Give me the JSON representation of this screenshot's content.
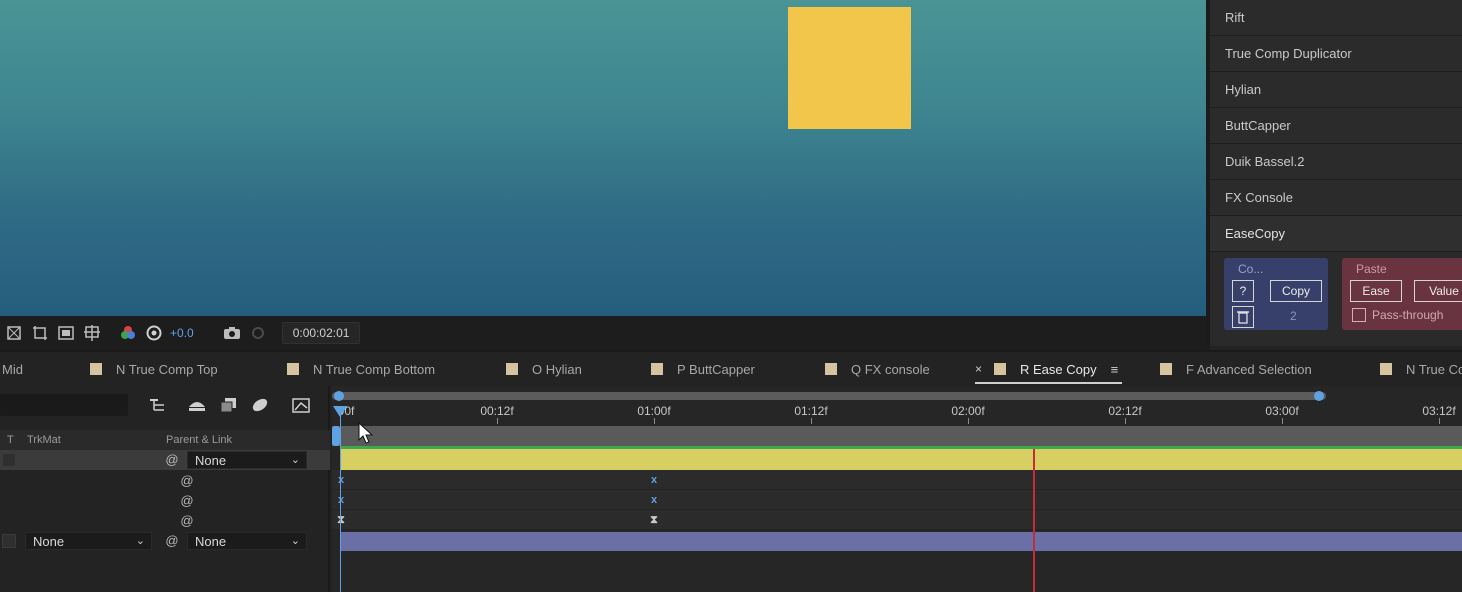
{
  "viewer": {
    "square_color": "#f2c64a",
    "exposure": "+0.0",
    "timecode": "0:00:02:01"
  },
  "scripts_panel": {
    "items": [
      "Rift",
      "True Comp Duplicator",
      "Hylian",
      "ButtCapper",
      "Duik Bassel.2",
      "FX Console",
      "EaseCopy"
    ],
    "easecopy": {
      "copy_group_label": "Co...",
      "help_label": "?",
      "copy_label": "Copy",
      "copy_count": "2",
      "paste_group_label": "Paste",
      "ease_label": "Ease",
      "value_label": "Value",
      "passthrough_label": "Pass-through",
      "passthrough_checked": false
    }
  },
  "tabs": [
    {
      "label": "Mid",
      "active": false
    },
    {
      "label": "N True Comp Top",
      "active": false
    },
    {
      "label": "N True Comp Bottom",
      "active": false
    },
    {
      "label": "O Hylian",
      "active": false
    },
    {
      "label": "P ButtCapper",
      "active": false
    },
    {
      "label": "Q FX console",
      "active": false
    },
    {
      "label": "R Ease Copy",
      "active": true
    },
    {
      "label": "F Advanced Selection",
      "active": false
    },
    {
      "label": "N True Co",
      "active": false
    }
  ],
  "tab_close": "×",
  "tab_menu": "≡",
  "layer_panel": {
    "columns": {
      "t": "T",
      "trkmat": "TrkMat",
      "parent": "Parent & Link"
    },
    "layer1_parent": "None",
    "layer2_trkmat": "None",
    "layer2_parent": "None",
    "spiral_glyph": "@"
  },
  "timeline": {
    "ticks": [
      "00f",
      "00:12f",
      "01:00f",
      "01:12f",
      "02:00f",
      "02:12f",
      "03:00f",
      "03:12f"
    ],
    "layer1_color": "#d8cf62",
    "layer2_color": "#6a70a6",
    "keyframe_glyph": "x",
    "hourglass_glyph": "⧗"
  }
}
